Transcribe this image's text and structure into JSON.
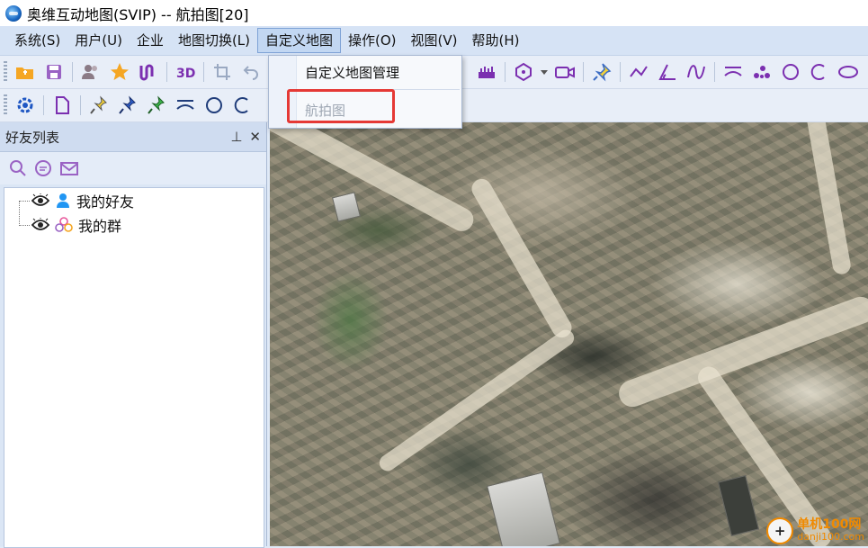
{
  "window": {
    "title": "奥维互动地图(SVIP) -- 航拍图[20]"
  },
  "menubar": {
    "items": [
      "系统(S)",
      "用户(U)",
      "企业",
      "地图切换(L)",
      "自定义地图",
      "操作(O)",
      "视图(V)",
      "帮助(H)"
    ],
    "active": "自定义地图"
  },
  "dropdown": {
    "items": [
      {
        "label": "自定义地图管理",
        "enabled": true
      },
      {
        "label": "航拍图",
        "enabled": false
      }
    ],
    "highlight_color": "#e53935"
  },
  "sidebar": {
    "title": "好友列表",
    "pin_glyph": "⊥",
    "close_glyph": "✕",
    "tree": [
      {
        "label": "我的好友",
        "icons": [
          "eye-icon",
          "user-icon"
        ]
      },
      {
        "label": "我的群",
        "icons": [
          "eye-icon",
          "group-icon"
        ]
      }
    ]
  },
  "watermark": {
    "logo_glyph": "+",
    "name": "单机100网",
    "url": "danji100.com"
  },
  "colors": {
    "menubar": "#d6e3f5",
    "accent": "#7b2fb0",
    "highlight": "#e53935"
  }
}
